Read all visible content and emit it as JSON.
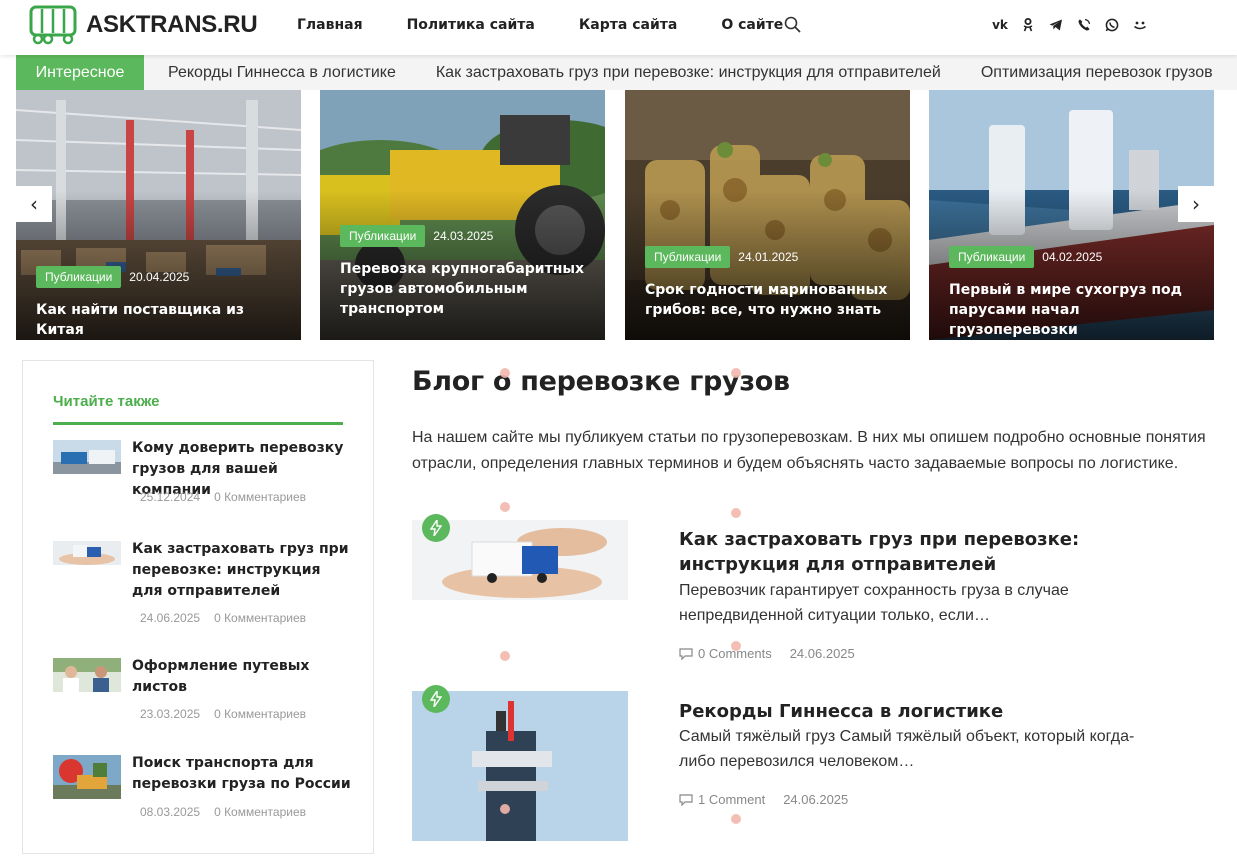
{
  "header": {
    "logo_text": "ASKTRANS.RU",
    "nav": [
      "Главная",
      "Политика сайта",
      "Карта сайта",
      "О сайте"
    ],
    "social": [
      "vk-icon",
      "ok-icon",
      "telegram-icon",
      "viber-icon",
      "whatsapp-icon",
      "yandex-zen-icon"
    ]
  },
  "ticker": {
    "label": "Интересное",
    "items": [
      "Рекорды Гиннесса в логистике",
      "Как застраховать груз при перевозке: инструкция для отправителей",
      "Оптимизация перевозок грузов"
    ]
  },
  "slider": {
    "prev_label": "‹",
    "next_label": "›",
    "slides": [
      {
        "badge": "Публикации",
        "date": "20.04.2025",
        "title": "Как найти поставщика из Китая"
      },
      {
        "badge": "Публикации",
        "date": "24.03.2025",
        "title": "Перевозка крупногабаритных грузов автомобильным транспортом"
      },
      {
        "badge": "Публикации",
        "date": "24.01.2025",
        "title": "Срок годности маринованных грибов: все, что нужно знать"
      },
      {
        "badge": "Публикации",
        "date": "04.02.2025",
        "title": "Первый в мире сухогруз под парусами начал грузоперевозки"
      }
    ]
  },
  "sidebar": {
    "title": "Читайте также",
    "items": [
      {
        "title": "Кому доверить перевозку грузов для вашей компании",
        "date": "25.12.2024",
        "comments": "0 Комментариев"
      },
      {
        "title": "Как застраховать груз при перевозке: инструкция для отправителей",
        "date": "24.06.2025",
        "comments": "0 Комментариев"
      },
      {
        "title": "Оформление путевых листов",
        "date": "23.03.2025",
        "comments": "0 Комментариев"
      },
      {
        "title": "Поиск транспорта для перевозки груза по России",
        "date": "08.03.2025",
        "comments": "0 Комментариев"
      }
    ]
  },
  "main": {
    "title": "Блог о перевозке грузов",
    "intro": "На нашем сайте мы публикуем статьи по грузоперевозкам. В них мы опишем подробно основные понятия отрасли, определения главных терминов и будем объяснять часто задаваемые вопросы по логистике.",
    "posts": [
      {
        "title": "Как застраховать груз при перевозке: инструкция для отправителей",
        "excerpt": "Перевозчик гарантирует сохранность груза в случае непредвиденной ситуации только, если…",
        "comments": "0 Comments",
        "date": "24.06.2025"
      },
      {
        "title": "Рекорды Гиннесса в логистике",
        "excerpt": "Самый тяжёлый груз Самый тяжёлый объект, который когда-либо перевозился человеком…",
        "comments": "1 Comment",
        "date": "24.06.2025"
      }
    ]
  },
  "colors": {
    "accent": "#5cb85c",
    "text": "#222222",
    "muted": "#999999"
  }
}
